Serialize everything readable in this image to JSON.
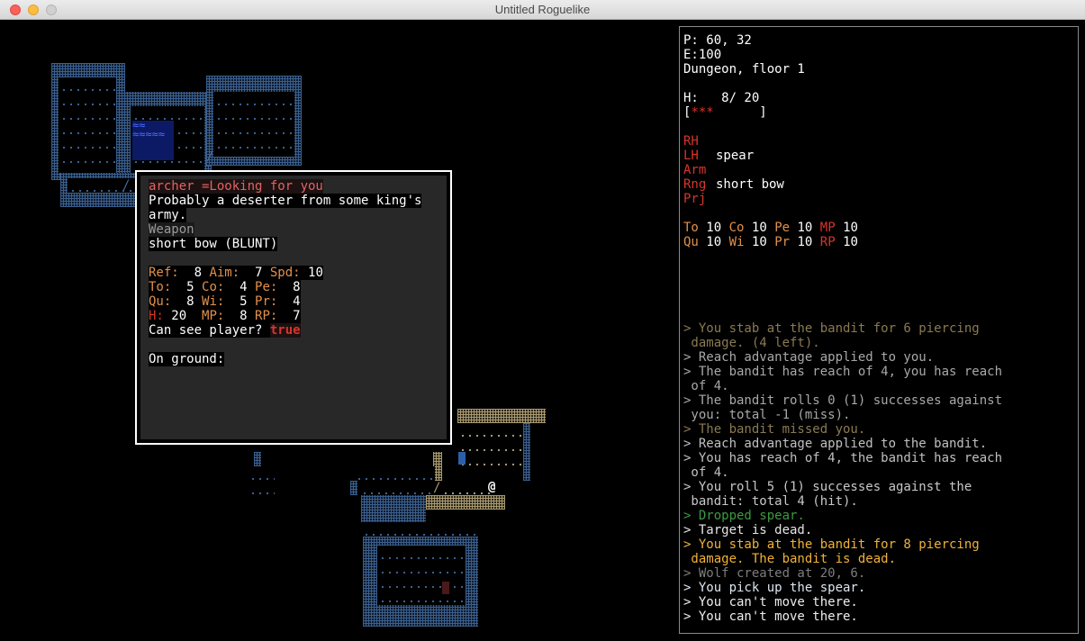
{
  "window": {
    "title": "Untitled Roguelike"
  },
  "map": {
    "player_glyph": "@",
    "door_glyph_1": "/",
    "door_glyph_2": "/",
    "door_glyph_3": "/",
    "water_text": "≈≈\n≈≈≈≈≈"
  },
  "popup": {
    "name_line": "archer =Looking for you",
    "desc_1": "Probably a deserter from some king's",
    "desc_2": "army.",
    "weapon_label": "Weapon",
    "weapon_value": "short bow (BLUNT)",
    "stats": [
      [
        {
          "label": "Ref:",
          "value": "  8 "
        },
        {
          "label": "Aim:",
          "value": "  7 "
        },
        {
          "label": "Spd:",
          "value": " 10"
        }
      ],
      [
        {
          "label": "To:",
          "value": "  5 "
        },
        {
          "label": "Co:",
          "value": "  4 "
        },
        {
          "label": "Pe:",
          "value": "  8"
        }
      ],
      [
        {
          "label": "Qu:",
          "value": "  8 "
        },
        {
          "label": "Wi:",
          "value": "  5 "
        },
        {
          "label": "Pr:",
          "value": "  4"
        }
      ],
      [
        {
          "label": "H:",
          "value": " 20  "
        },
        {
          "label": "MP:",
          "value": "  8 "
        },
        {
          "label": "RP:",
          "value": "  7"
        }
      ]
    ],
    "see_label": "Can see player? ",
    "see_value": "true",
    "ground_label": "On ground:"
  },
  "status": {
    "position": "P: 60, 32",
    "energy": "E:100",
    "location": "Dungeon, floor 1",
    "health": "H:   8/ 20",
    "health_bar_open": "[",
    "health_bar_fill": "***",
    "health_bar_close": "      ]",
    "health_fraction": 0.4
  },
  "equipment": [
    {
      "slot": "RH",
      "item": ""
    },
    {
      "slot": "LH",
      "item": "spear"
    },
    {
      "slot": "Arm",
      "item": ""
    },
    {
      "slot": "Rng",
      "item": "short bow"
    },
    {
      "slot": "Prj",
      "item": ""
    }
  ],
  "attributes": [
    [
      {
        "label": "To",
        "value": "10",
        "color": "orange"
      },
      {
        "label": "Co",
        "value": "10",
        "color": "orange"
      },
      {
        "label": "Pe",
        "value": "10",
        "color": "orange"
      },
      {
        "label": "MP",
        "value": "10",
        "color": "red"
      }
    ],
    [
      {
        "label": "Qu",
        "value": "10",
        "color": "orange"
      },
      {
        "label": "Wi",
        "value": "10",
        "color": "orange"
      },
      {
        "label": "Pr",
        "value": "10",
        "color": "orange"
      },
      {
        "label": "RP",
        "value": "10",
        "color": "red"
      }
    ]
  ],
  "log": [
    {
      "text": "> You stab at the bandit for 6 piercing",
      "color": "#8a7a52"
    },
    {
      "text": " damage. (4 left).",
      "color": "#8a7a52"
    },
    {
      "text": "> Reach advantage applied to you.",
      "color": "#a8a8a8"
    },
    {
      "text": "> The bandit has reach of 4, you has reach",
      "color": "#a8a8a8"
    },
    {
      "text": " of 4.",
      "color": "#a8a8a8"
    },
    {
      "text": "> The bandit rolls 0 (1) successes against",
      "color": "#a8a8a8"
    },
    {
      "text": " you: total -1 (miss).",
      "color": "#a8a8a8"
    },
    {
      "text": "> The bandit missed you.",
      "color": "#8a7a52"
    },
    {
      "text": "> Reach advantage applied to the bandit.",
      "color": "#c0c0c0"
    },
    {
      "text": "> You has reach of 4, the bandit has reach",
      "color": "#c0c0c0"
    },
    {
      "text": " of 4.",
      "color": "#c0c0c0"
    },
    {
      "text": "> You roll 5 (1) successes against the",
      "color": "#c8c8c8"
    },
    {
      "text": " bandit: total 4 (hit).",
      "color": "#c8c8c8"
    },
    {
      "text": "> Dropped spear.",
      "color": "#3f9a3f"
    },
    {
      "text": "> Target is dead.",
      "color": "#e4e4e4"
    },
    {
      "text": "> You stab at the bandit for 8 piercing",
      "color": "#f0b238"
    },
    {
      "text": " damage. The bandit is dead.",
      "color": "#f0b238"
    },
    {
      "text": "> Wolf created at 20, 6.",
      "color": "#7d7d7d"
    },
    {
      "text": "> You pick up the spear.",
      "color": "#dde6ee"
    },
    {
      "text": "> You can't move there.",
      "color": "#ededed"
    },
    {
      "text": "> You can't move there.",
      "color": "#ededed"
    }
  ]
}
